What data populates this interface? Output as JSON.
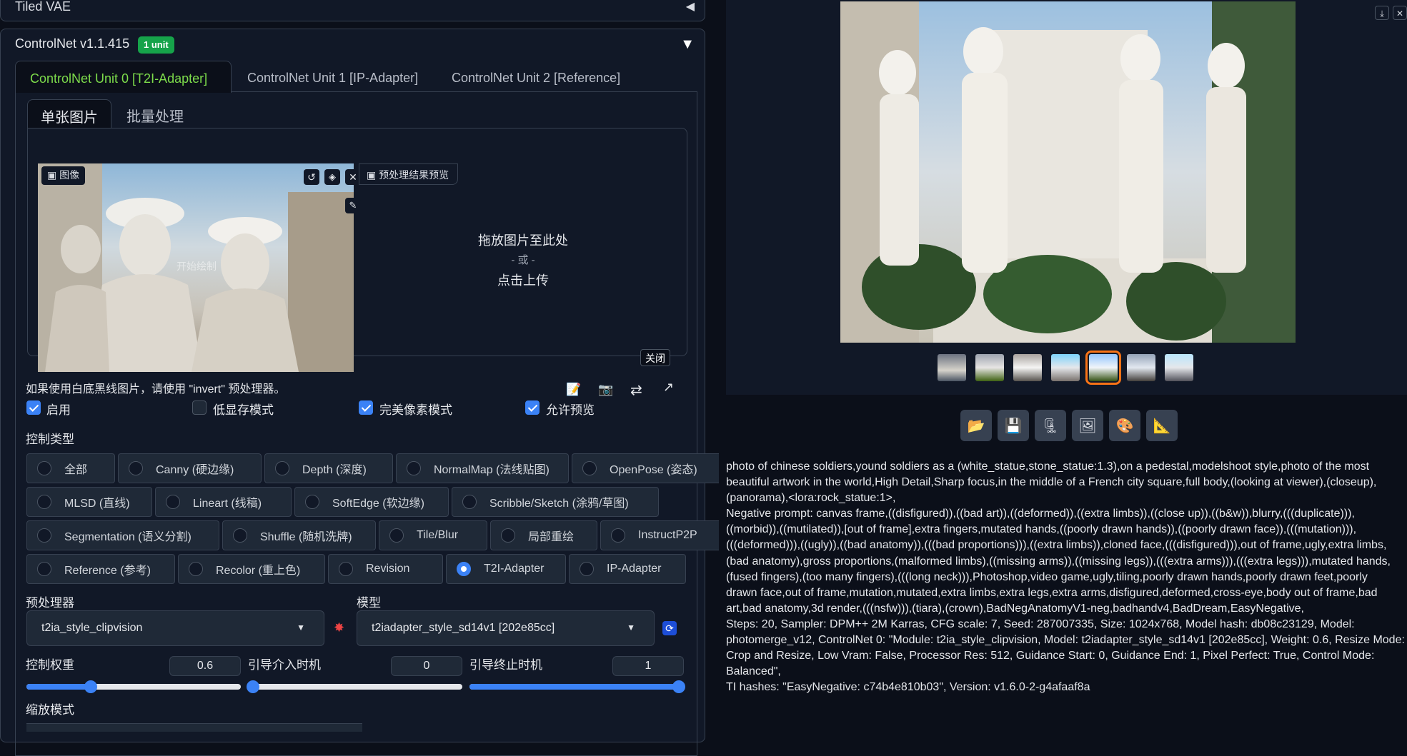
{
  "tiled_vae": {
    "label": "Tiled VAE",
    "arrow": "◀"
  },
  "controlnet": {
    "title": "ControlNet v1.1.415",
    "badge": "1 unit",
    "collapse": "▼",
    "unit_tabs": [
      "ControlNet Unit 0 [T2I-Adapter]",
      "ControlNet Unit 1 [IP-Adapter]",
      "ControlNet Unit 2 [Reference]"
    ],
    "mode_tabs": [
      "单张图片",
      "批量处理"
    ],
    "image_label": "图像",
    "preview_label": "预处理结果预览",
    "drop": {
      "line1": "拖放图片至此处",
      "line2": "- 或 -",
      "line3": "点击上传"
    },
    "close_label": "关闭",
    "watermark": "开始绘制",
    "hint": "如果使用白底黑线图片，请使用 \"invert\" 预处理器。",
    "checkboxes": [
      {
        "label": "启用",
        "checked": true
      },
      {
        "label": "低显存模式",
        "checked": false
      },
      {
        "label": "完美像素模式",
        "checked": true
      },
      {
        "label": "允许预览",
        "checked": true
      }
    ],
    "control_type_label": "控制类型",
    "control_types": [
      [
        "全部",
        "Canny (硬边缘)",
        "Depth (深度)",
        "NormalMap (法线贴图)",
        "OpenPose (姿态)"
      ],
      [
        "MLSD (直线)",
        "Lineart (线稿)",
        "SoftEdge (软边缘)",
        "Scribble/Sketch (涂鸦/草图)"
      ],
      [
        "Segmentation (语义分割)",
        "Shuffle (随机洗牌)",
        "Tile/Blur",
        "局部重绘",
        "InstructP2P"
      ],
      [
        "Reference (参考)",
        "Recolor (重上色)",
        "Revision",
        "T2I-Adapter",
        "IP-Adapter"
      ]
    ],
    "selected_type": "T2I-Adapter",
    "preprocessor_label": "预处理器",
    "preprocessor_value": "t2ia_style_clipvision",
    "model_label": "模型",
    "model_value": "t2iadapter_style_sd14v1 [202e85cc]",
    "weight_label": "控制权重",
    "weight_value": "0.6",
    "start_label": "引导介入时机",
    "start_value": "0",
    "end_label": "引导终止时机",
    "end_value": "1",
    "resize_label": "缩放模式",
    "weight_fraction": 0.3,
    "start_fraction": 0.0,
    "end_fraction": 1.0
  },
  "output": {
    "selected_thumb_index": 4,
    "thumb_count": 7,
    "tool_icons": [
      "folder-icon",
      "save-icon",
      "zip-icon",
      "image-icon",
      "palette-icon",
      "ruler-icon"
    ],
    "tool_glyphs": [
      "📂",
      "💾",
      "🗜",
      "🖼",
      "🎨",
      "📐"
    ],
    "prompt": "photo of chinese soldiers,yound soldiers as a (white_statue,stone_statue:1.3),on a pedestal,modelshoot style,photo of the most\nbeautiful artwork in the world,High Detail,Sharp focus,in the middle of a French city square,full body,(looking at viewer),(closeup),\n(panorama),<lora:rock_statue:1>,\nNegative prompt: canvas frame,((disfigured)),((bad art)),((deformed)),((extra limbs)),((close up)),((b&w)),blurry,(((duplicate))),\n((morbid)),((mutilated)),[out of frame],extra fingers,mutated hands,((poorly drawn hands)),((poorly drawn face)),(((mutation))),\n(((deformed))),((ugly)),((bad anatomy)),(((bad proportions))),((extra limbs)),cloned face,(((disfigured))),out of frame,ugly,extra limbs,\n(bad anatomy),gross proportions,(malformed limbs),((missing arms)),((missing legs)),(((extra arms))),(((extra legs))),mutated hands,\n(fused fingers),(too many fingers),(((long neck))),Photoshop,video game,ugly,tiling,poorly drawn hands,poorly drawn feet,poorly\ndrawn face,out of frame,mutation,mutated,extra limbs,extra legs,extra arms,disfigured,deformed,cross-eye,body out of frame,bad\nart,bad anatomy,3d render,(((nsfw))),(tiara),(crown),BadNegAnatomyV1-neg,badhandv4,BadDream,EasyNegative,\nSteps: 20, Sampler: DPM++ 2M Karras, CFG scale: 7, Seed: 287007335, Size: 1024x768, Model hash: db08c23129, Model:\nphotomerge_v12, ControlNet 0: \"Module: t2ia_style_clipvision, Model: t2iadapter_style_sd14v1 [202e85cc], Weight: 0.6, Resize Mode:\nCrop and Resize, Low Vram: False, Processor Res: 512, Guidance Start: 0, Guidance End: 1, Pixel Perfect: True, Control Mode: Balanced\",\nTI hashes: \"EasyNegative: c74b4e810b03\", Version: v1.6.0-2-g4afaaf8a"
  }
}
